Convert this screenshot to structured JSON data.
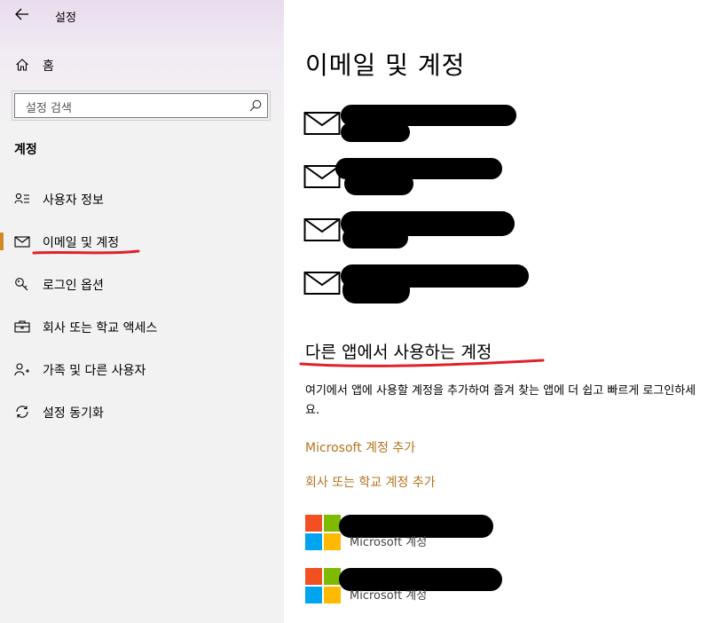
{
  "window": {
    "title": "설정",
    "back_glyph": "←"
  },
  "sidebar": {
    "home_label": "홈",
    "search_placeholder": "설정 검색",
    "section_title": "계정",
    "items": [
      {
        "label": "사용자 정보",
        "icon": "person-card-icon"
      },
      {
        "label": "이메일 및 계정",
        "icon": "mail-icon",
        "selected": true
      },
      {
        "label": "로그인 옵션",
        "icon": "key-icon"
      },
      {
        "label": "회사 또는 학교 액세스",
        "icon": "briefcase-icon"
      },
      {
        "label": "가족 및 다른 사용자",
        "icon": "person-add-icon"
      },
      {
        "label": "설정 동기화",
        "icon": "sync-icon"
      }
    ],
    "accent_color": "#d08a2a"
  },
  "main": {
    "page_title": "이메일 및 계정",
    "email_accounts_count": 4,
    "other_apps_heading": "다른 앱에서 사용하는 계정",
    "description": "여기에서 앱에 사용할 계정을 추가하여 즐겨 찾는 앱에 더 쉽고 빠르게 로그인하세요.",
    "add_ms_link": "Microsoft 계정 추가",
    "add_work_link": "회사 또는 학교 계정 추가",
    "ms_accounts": [
      {
        "type_label": "Microsoft 계정"
      },
      {
        "type_label": "Microsoft 계정"
      }
    ],
    "link_color": "#b5731c"
  },
  "annotations": {
    "underline_color": "#e0202a"
  }
}
